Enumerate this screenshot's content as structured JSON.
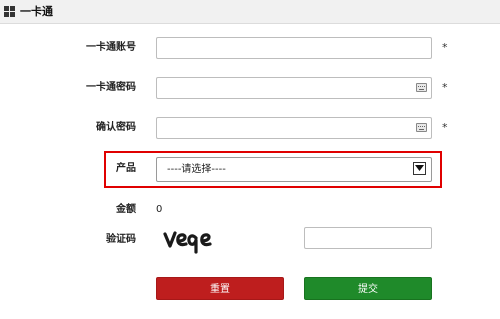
{
  "window": {
    "title": "一卡通"
  },
  "form": {
    "account_label": "一卡通账号",
    "account_value": "",
    "account_required": "*",
    "password_label": "一卡通密码",
    "password_value": "",
    "password_required": "*",
    "confirm_label": "确认密码",
    "confirm_value": "",
    "confirm_required": "*",
    "product_label": "产品",
    "product_selected": "----请选择----",
    "amount_label": "金额",
    "amount_value": "0",
    "captcha_label": "验证码",
    "captcha_image_text": "veqe",
    "captcha_value": ""
  },
  "buttons": {
    "reset_label": "重置",
    "submit_label": "提交"
  },
  "colors": {
    "highlight_border": "#e00000",
    "reset_button": "#be1e1e",
    "submit_button": "#1f8a2a"
  },
  "icons": {
    "title": "grid-icon",
    "password_fields": "keyboard-icon",
    "select": "chevron-down-icon"
  }
}
